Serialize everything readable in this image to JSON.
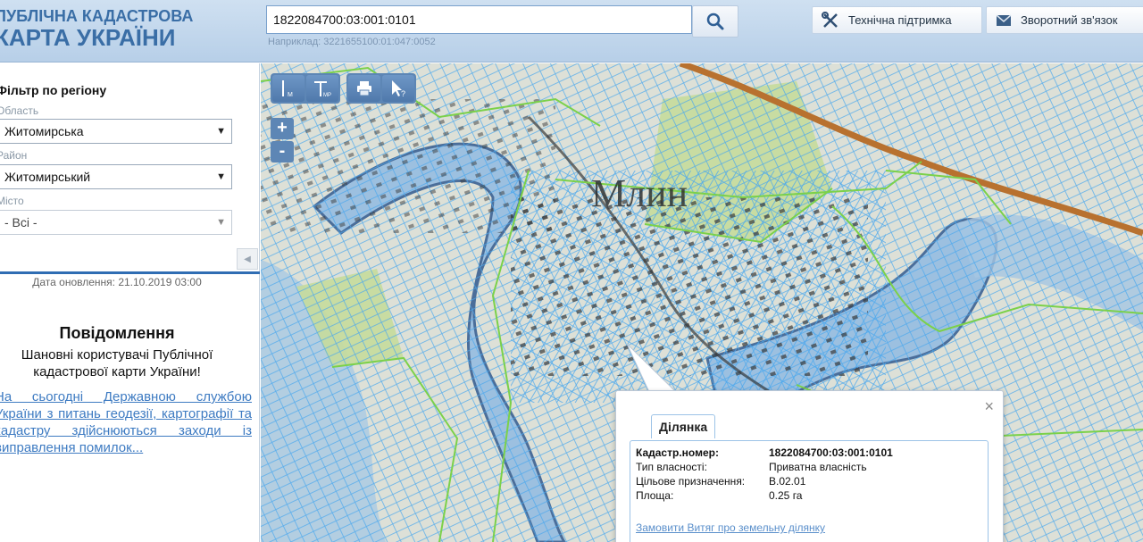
{
  "header": {
    "logo_line1": "ПУБЛІЧНА КАДАСТРОВА",
    "logo_line2": "КАРТА УКРАЇНИ",
    "search_value": "1822084700:03:001:0101",
    "search_hint": "Наприклад: 3221655100:01:047:0052",
    "support_label": "Технічна підтримка",
    "feedback_label": "Зворотний зв'язок"
  },
  "sidebar": {
    "filter_title": "Фільтр по регіону",
    "oblast_label": "Область",
    "oblast_value": "Житомирська",
    "rayon_label": "Район",
    "rayon_value": "Житомирський",
    "misto_label": "Місто",
    "misto_value": "- Всі -",
    "update_date": "Дата оновлення: 21.10.2019 03:00",
    "notice_title": "Повідомлення",
    "notice_body": "Шановні користувачі Публічної кадастрової карти України!",
    "notice_link": "На сьогодні Державною службою України з питань геодезії, картографії та кадастру здійснюються заходи із виправлення помилок..."
  },
  "map": {
    "place_label": "Млин",
    "zoom_in": "+",
    "zoom_out": "-",
    "tools": [
      "ruler-icon",
      "area-icon",
      "print-icon",
      "info-cursor-icon"
    ]
  },
  "popup": {
    "tab": "Ділянка",
    "close": "×",
    "rows": [
      {
        "key": "Кадастр.номер:",
        "value": "1822084700:03:001:0101"
      },
      {
        "key": "Тип власності:",
        "value": "Приватна власність"
      },
      {
        "key": "Цільове призначення:",
        "value": "В.02.01"
      },
      {
        "key": "Площа:",
        "value": "0.25 га"
      }
    ],
    "link": "Замовити Витяг про земельну ділянку"
  }
}
